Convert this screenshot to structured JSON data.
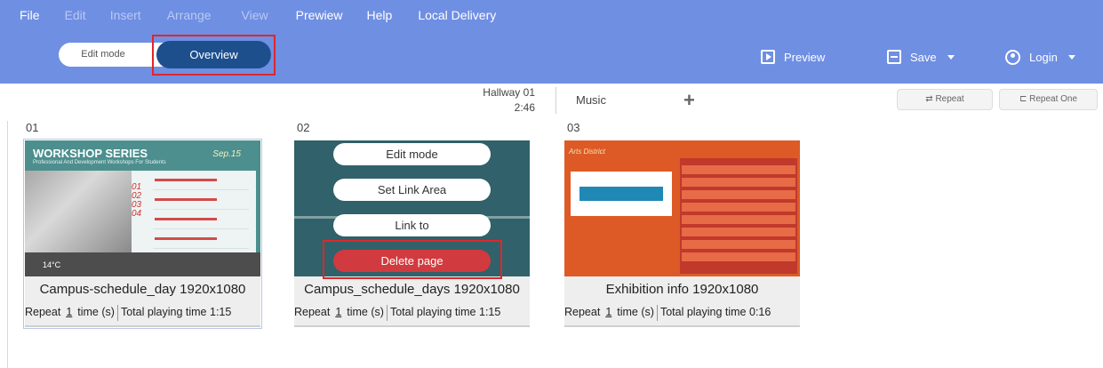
{
  "menu": {
    "file": "File",
    "edit": "Edit",
    "insert": "Insert",
    "arrange": "Arrange",
    "view": "View",
    "prewiew": "Prewiew",
    "help": "Help",
    "local_delivery": "Local Delivery"
  },
  "mode_toggle": {
    "edit_mode": "Edit mode",
    "overview": "Overview",
    "active": "Overview"
  },
  "toolbar": {
    "preview": "Preview",
    "save": "Save",
    "login": "Login"
  },
  "playlist_bar": {
    "hallway_name": "Hallway 01",
    "hallway_time": "2:46",
    "music": "Music",
    "add": "+",
    "repeat": "Repeat",
    "repeat_one": "Repeat One"
  },
  "pages": [
    {
      "number": "01",
      "title": "Campus-schedule_day 1920x1080",
      "repeat_label": "Repeat",
      "repeat_count": "1",
      "time_label": "time (s)",
      "total_label": "Total playing time 1:15",
      "thumb": {
        "heading": "WORKSHOP SERIES",
        "subheading": "Professional And Development Workshops For Students",
        "date": "Sep.15",
        "indices": [
          "01",
          "02",
          "03",
          "04"
        ],
        "temperature": "14°C"
      }
    },
    {
      "number": "02",
      "title": "Campus_schedule_days 1920x1080",
      "repeat_label": "Repeat",
      "repeat_count": "1",
      "time_label": "time (s)",
      "total_label": "Total playing time 1:15"
    },
    {
      "number": "03",
      "title": "Exhibition info 1920x1080",
      "repeat_label": "Repeat",
      "repeat_count": "1",
      "time_label": "time (s)",
      "total_label": "Total playing time 0:16",
      "thumb": {
        "heading": "Arts District"
      }
    }
  ],
  "context_menu": {
    "edit_mode": "Edit mode",
    "set_link_area": "Set Link Area",
    "link_to": "Link to",
    "delete_page": "Delete page"
  },
  "colors": {
    "topbar": "#6f8fe3",
    "overview_active": "#1d4f8d",
    "highlight_box": "#e0262a",
    "delete_button": "#d13a3e"
  }
}
